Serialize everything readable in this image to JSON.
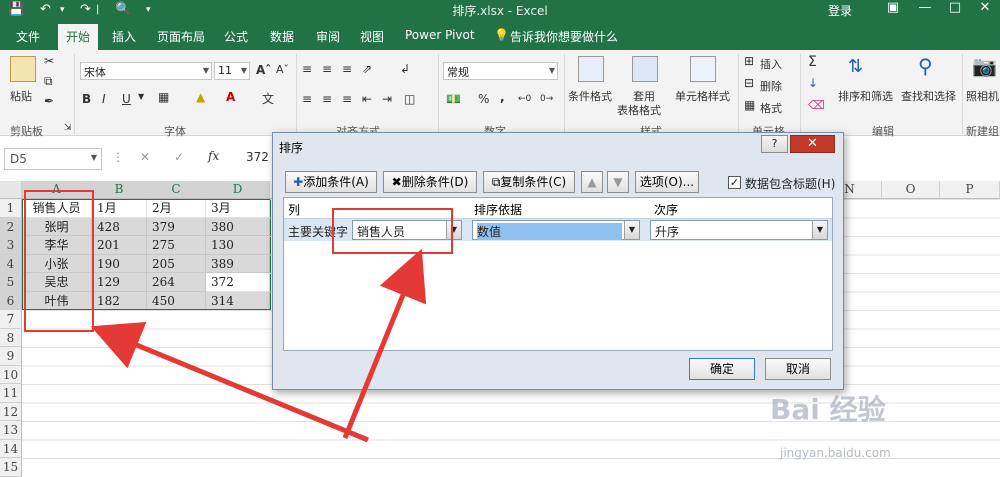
{
  "window": {
    "title": "排序.xlsx - Excel",
    "login": "登录"
  },
  "tabs": [
    "文件",
    "开始",
    "插入",
    "页面布局",
    "公式",
    "数据",
    "审阅",
    "视图",
    "Power Pivot"
  ],
  "tell_me": "告诉我你想要做什么",
  "ribbon": {
    "paste": "粘贴",
    "clipboard_group": "剪贴板",
    "font_name": "宋体",
    "font_size": "11",
    "bold": "B",
    "italic": "I",
    "underline": "U",
    "font_group": "字体",
    "align_group": "对齐方式",
    "number_format": "常规",
    "percent": "%",
    "comma": ",",
    "number_group": "数字",
    "conditional_format": "条件格式",
    "table_format_1": "套用",
    "table_format_2": "表格格式",
    "cell_style": "单元格样式",
    "styles_group": "样式",
    "insert": "插入",
    "delete": "删除",
    "format": "格式",
    "cells_group": "单元格",
    "sort_filter": "排序和筛选",
    "find_select": "查找和选择",
    "edit_group": "编辑",
    "camera": "照相机",
    "new_group": "新建组"
  },
  "formula_bar": {
    "name_box": "D5",
    "fx": "fx",
    "value": "372"
  },
  "grid": {
    "columns": [
      "A",
      "B",
      "C",
      "D",
      "N",
      "O",
      "P"
    ],
    "rows": [
      "1",
      "2",
      "3",
      "4",
      "5",
      "6",
      "7",
      "8",
      "9",
      "10",
      "11",
      "12",
      "13",
      "14",
      "15"
    ],
    "cells": [
      [
        "销售人员",
        "1月",
        "2月",
        "3月"
      ],
      [
        "张明",
        "428",
        "379",
        "380"
      ],
      [
        "李华",
        "201",
        "275",
        "130"
      ],
      [
        "小张",
        "190",
        "205",
        "389"
      ],
      [
        "吴忠",
        "129",
        "264",
        "372"
      ],
      [
        "叶伟",
        "182",
        "450",
        "314"
      ]
    ]
  },
  "dialog": {
    "title": "排序",
    "help": "?",
    "add_level": "添加条件(A)",
    "delete_level": "删除条件(D)",
    "copy_level": "复制条件(C)",
    "options": "选项(O)...",
    "header_checkbox": "数据包含标题(H)",
    "col_header": "列",
    "sort_on_header": "排序依据",
    "order_header": "次序",
    "primary_key": "主要关键字",
    "key_value": "销售人员",
    "sort_on_value": "数值",
    "order_value": "升序",
    "ok": "确定",
    "cancel": "取消"
  },
  "watermark": {
    "brand": "Bai 经验",
    "url": "jingyan.baidu.com"
  }
}
